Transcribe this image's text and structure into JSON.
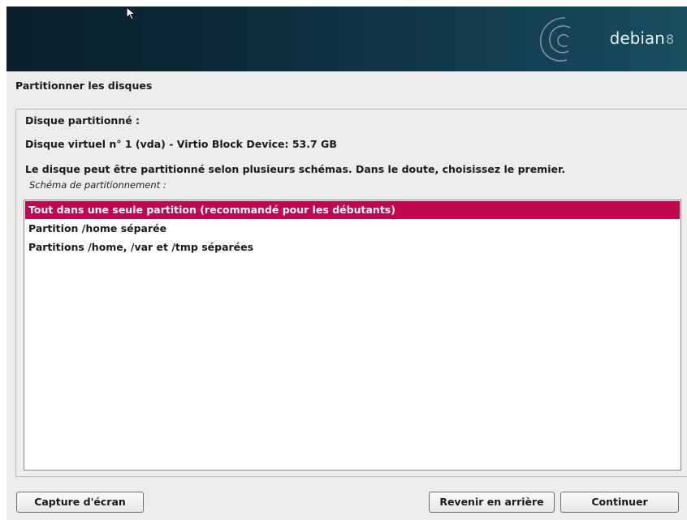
{
  "header": {
    "brand_text": "debian",
    "brand_version": "8"
  },
  "page": {
    "title": "Partitionner les disques"
  },
  "panel": {
    "disk_heading": "Disque partitionné :",
    "disk_name": "Disque virtuel n° 1 (vda) - Virtio Block Device: 53.7 GB",
    "description": "Le disque peut être partitionné selon plusieurs schémas. Dans le doute, choisissez le premier.",
    "scheme_label": "Schéma de partitionnement :"
  },
  "schemes": [
    {
      "label": "Tout dans une seule partition (recommandé pour les débutants)",
      "selected": true
    },
    {
      "label": "Partition /home séparée",
      "selected": false
    },
    {
      "label": "Partitions /home, /var et /tmp séparées",
      "selected": false
    }
  ],
  "buttons": {
    "screenshot": "Capture d'écran",
    "back": "Revenir en arrière",
    "continue": "Continuer"
  },
  "colors": {
    "selection": "#c0074f",
    "banner": "#0d2c3b",
    "background": "#ededec"
  },
  "icons": {
    "logo": "debian-swirl-icon",
    "cursor": "mouse-pointer-icon"
  }
}
